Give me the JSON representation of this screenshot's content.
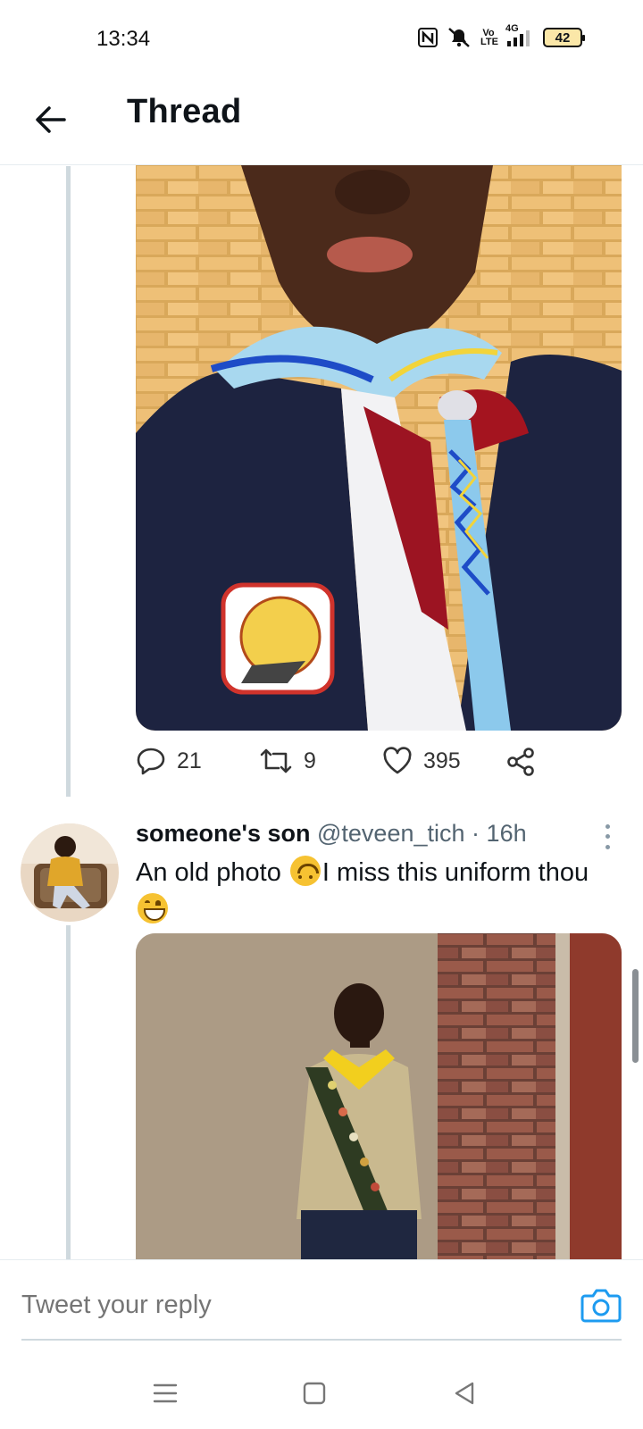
{
  "status_bar": {
    "time": "13:34",
    "network": "4G",
    "volte": "Vo LTE",
    "battery": "42",
    "icons": [
      "nfc-icon",
      "mute-icon",
      "volte-icon",
      "signal-icon",
      "battery-icon"
    ]
  },
  "header": {
    "title": "Thread",
    "back_icon": "arrow-left-icon"
  },
  "tweet_1": {
    "media_description_icon": "photo",
    "actions": {
      "reply_count": "21",
      "retweet_count": "9",
      "like_count": "395"
    }
  },
  "tweet_2": {
    "name": "someone's son",
    "handle": "@teveen_tich",
    "separator": "·",
    "time": "16h",
    "text_part1": "An old photo ",
    "text_part2": "I miss this uniform thou",
    "emojis": [
      "upside-down-face",
      "grinning-face"
    ]
  },
  "reply": {
    "placeholder": "Tweet your reply"
  },
  "colors": {
    "accent": "#1d9bf0",
    "thread_line": "#cfd9de",
    "muted_text": "#536471"
  }
}
